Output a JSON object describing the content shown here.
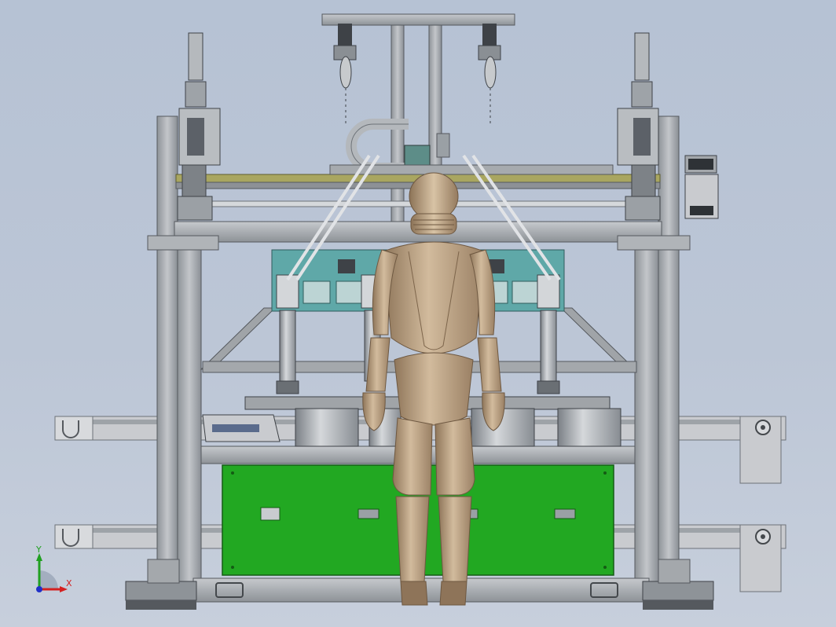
{
  "viewport": {
    "background_top": "#b6c2d4",
    "background_bottom": "#c7cfdc"
  },
  "triad": {
    "x_label": "X",
    "y_label": "Y",
    "x_color": "#d42020",
    "y_color": "#20a020",
    "z_color": "#2030c8"
  },
  "colors": {
    "frame": "#a8acb0",
    "frame_dark": "#6d7278",
    "panel_green": "#22a822",
    "bracket_teal": "#5fa8a8",
    "rail_yellow": "#a9a660",
    "mannequin": "#c4ab8c",
    "mannequin_shadow": "#8e7459"
  },
  "icons": [
    "coordinate-triad-icon"
  ]
}
